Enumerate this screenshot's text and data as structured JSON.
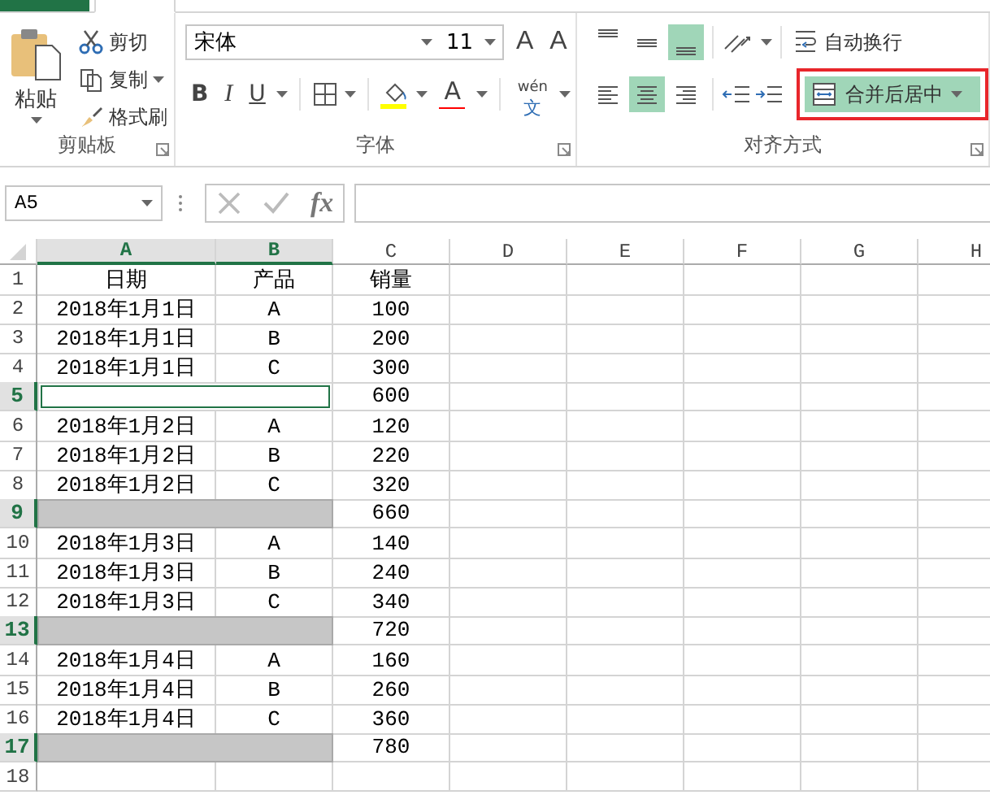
{
  "clipboard": {
    "label": "剪贴板",
    "paste": "粘贴",
    "cut": "剪切",
    "copy": "复制",
    "format_painter": "格式刷"
  },
  "font": {
    "label": "字体",
    "font_name": "宋体",
    "font_size": "11",
    "grow_font": "A",
    "shrink_font": "A",
    "bold": "B",
    "italic": "I",
    "underline": "U",
    "font_color": "A",
    "phonetic_top": "wén",
    "phonetic_bottom": "文"
  },
  "alignment": {
    "label": "对齐方式",
    "vertical_align": [
      {
        "selected": false
      },
      {
        "selected": false
      },
      {
        "selected": true
      }
    ],
    "horizontal_align": [
      {
        "selected": false
      },
      {
        "selected": true
      },
      {
        "selected": false
      }
    ],
    "wrap_text": "自动换行",
    "merge_center": {
      "label": "合并后居中",
      "selected": true,
      "highlighted": true
    }
  },
  "formula_bar": {
    "name_box": "A5",
    "insert_function": "fx"
  },
  "sheet": {
    "columns": [
      {
        "label": "A",
        "selected": true
      },
      {
        "label": "B",
        "selected": true
      },
      {
        "label": "C",
        "selected": false
      },
      {
        "label": "D",
        "selected": false
      },
      {
        "label": "E",
        "selected": false
      },
      {
        "label": "F",
        "selected": false
      },
      {
        "label": "G",
        "selected": false
      },
      {
        "label": "H",
        "selected": false
      }
    ],
    "rows": [
      {
        "number": "1",
        "selected": false,
        "kind": "data",
        "cells": [
          "日期",
          "产品",
          "销量"
        ]
      },
      {
        "number": "2",
        "selected": false,
        "kind": "data",
        "cells": [
          "2018年1月1日",
          "A",
          "100"
        ]
      },
      {
        "number": "3",
        "selected": false,
        "kind": "data",
        "cells": [
          "2018年1月1日",
          "B",
          "200"
        ]
      },
      {
        "number": "4",
        "selected": false,
        "kind": "data",
        "cells": [
          "2018年1月1日",
          "C",
          "300"
        ]
      },
      {
        "number": "5",
        "selected": true,
        "kind": "merged",
        "active": true,
        "cells": [
          "600"
        ]
      },
      {
        "number": "6",
        "selected": false,
        "kind": "data",
        "cells": [
          "2018年1月2日",
          "A",
          "120"
        ]
      },
      {
        "number": "7",
        "selected": false,
        "kind": "data",
        "cells": [
          "2018年1月2日",
          "B",
          "220"
        ]
      },
      {
        "number": "8",
        "selected": false,
        "kind": "data",
        "cells": [
          "2018年1月2日",
          "C",
          "320"
        ]
      },
      {
        "number": "9",
        "selected": true,
        "kind": "merged",
        "active": false,
        "cells": [
          "660"
        ]
      },
      {
        "number": "10",
        "selected": false,
        "kind": "data",
        "cells": [
          "2018年1月3日",
          "A",
          "140"
        ]
      },
      {
        "number": "11",
        "selected": false,
        "kind": "data",
        "cells": [
          "2018年1月3日",
          "B",
          "240"
        ]
      },
      {
        "number": "12",
        "selected": false,
        "kind": "data",
        "cells": [
          "2018年1月3日",
          "C",
          "340"
        ]
      },
      {
        "number": "13",
        "selected": true,
        "kind": "merged",
        "active": false,
        "cells": [
          "720"
        ]
      },
      {
        "number": "14",
        "selected": false,
        "kind": "data",
        "cells": [
          "2018年1月4日",
          "A",
          "160"
        ]
      },
      {
        "number": "15",
        "selected": false,
        "kind": "data",
        "cells": [
          "2018年1月4日",
          "B",
          "260"
        ]
      },
      {
        "number": "16",
        "selected": false,
        "kind": "data",
        "cells": [
          "2018年1月4日",
          "C",
          "360"
        ]
      },
      {
        "number": "17",
        "selected": true,
        "kind": "merged",
        "active": false,
        "cells": [
          "780"
        ]
      },
      {
        "number": "18",
        "selected": false,
        "kind": "data"
      }
    ]
  }
}
